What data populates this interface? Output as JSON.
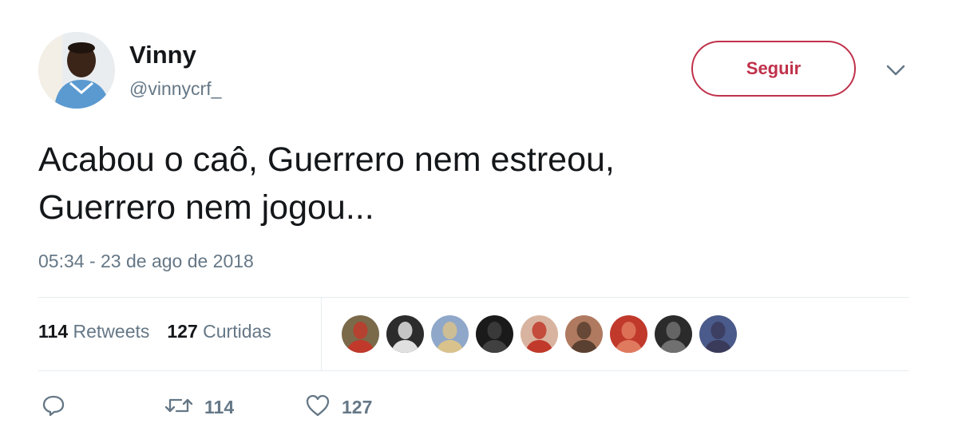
{
  "user": {
    "name": "Vinny",
    "handle": "@vinnycrf_"
  },
  "follow_button": {
    "label": "Seguir"
  },
  "tweet": {
    "text_line1": "Acabou o caô, Guerrero nem estreou,",
    "text_line2": "Guerrero nem jogou...",
    "timestamp": "05:34 - 23 de ago de 2018"
  },
  "stats": {
    "retweets_count": "114",
    "retweets_label": "Retweets",
    "likes_count": "127",
    "likes_label": "Curtidas"
  },
  "actions": {
    "reply_icon": "reply-icon",
    "retweet_icon": "retweet-icon",
    "retweet_count": "114",
    "like_icon": "heart-icon",
    "like_count": "127"
  },
  "colors": {
    "accent": "#c0314b",
    "text_primary": "#14171a",
    "text_secondary": "#657786",
    "divider": "#e6ecf0"
  },
  "liker_avatars": [
    {
      "colors": [
        "#7a6a4a",
        "#c0392b"
      ]
    },
    {
      "colors": [
        "#2c2c2c",
        "#e0e0e0"
      ]
    },
    {
      "colors": [
        "#8fa7c9",
        "#d9c28c"
      ]
    },
    {
      "colors": [
        "#1a1a1a",
        "#404040"
      ]
    },
    {
      "colors": [
        "#d8b4a0",
        "#c0392b"
      ]
    },
    {
      "colors": [
        "#b07a60",
        "#5a4030"
      ]
    },
    {
      "colors": [
        "#c0392b",
        "#e07a5f"
      ]
    },
    {
      "colors": [
        "#2b2b2b",
        "#707070"
      ]
    },
    {
      "colors": [
        "#4a5a8a",
        "#3a3a5a"
      ]
    }
  ]
}
